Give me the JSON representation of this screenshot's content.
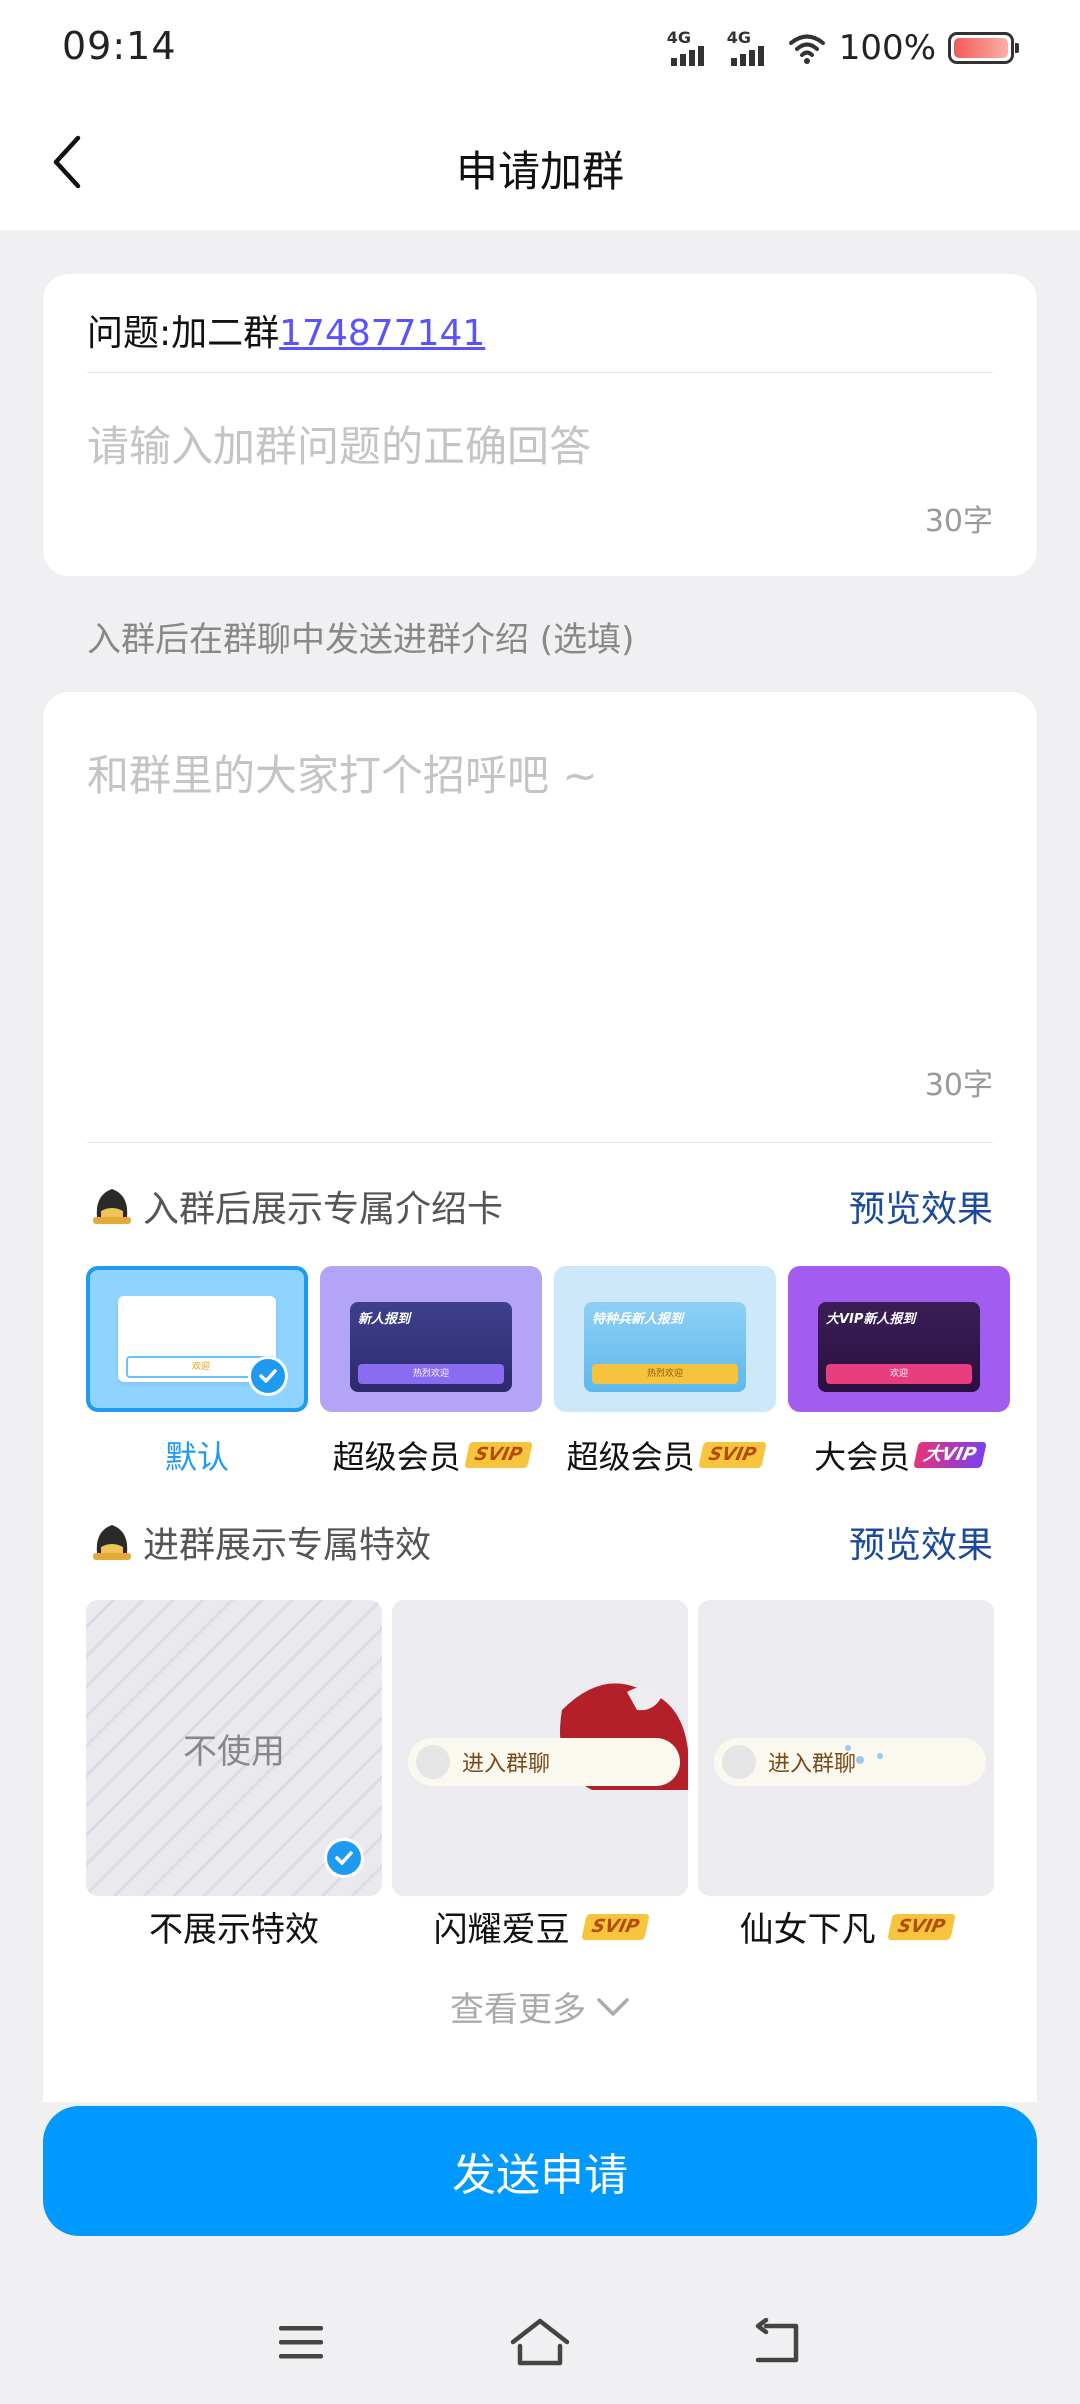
{
  "status_bar": {
    "time": "09:14",
    "signal_label": "4G",
    "battery_pct": "100%"
  },
  "header": {
    "title": "申请加群"
  },
  "question": {
    "prefix": "问题:加二群",
    "number": "174877141",
    "answer_placeholder": "请输入加群问题的正确回答",
    "counter": "30字"
  },
  "intro_hint": "入群后在群聊中发送进群介绍 (选填)",
  "intro": {
    "placeholder": "和群里的大家打个招呼吧 ~",
    "counter": "30字"
  },
  "intro_card_section": {
    "title": "入群后展示专属介绍卡",
    "preview": "预览效果",
    "cards": [
      {
        "label": "默认",
        "badge": "",
        "inner_title": "",
        "inner_button": "欢迎",
        "selected": true
      },
      {
        "label": "超级会员",
        "badge": "SVIP",
        "inner_title": "新人报到",
        "inner_button": "热烈欢迎"
      },
      {
        "label": "超级会员",
        "badge": "SVIP",
        "inner_title": "特种兵新人报到",
        "inner_button": "热烈欢迎"
      },
      {
        "label": "大会员",
        "badge": "大VIP",
        "inner_title": "大VIP新人报到",
        "inner_button": "欢迎"
      }
    ]
  },
  "effects_section": {
    "title": "进群展示专属特效",
    "preview": "预览效果",
    "none_text": "不使用",
    "pill_text": "进入群聊",
    "effects": [
      {
        "label": "不展示特效",
        "badge": "",
        "selected": true
      },
      {
        "label": "闪耀爱豆",
        "badge": "SVIP"
      },
      {
        "label": "仙女下凡",
        "badge": "SVIP"
      }
    ],
    "see_more": "查看更多"
  },
  "submit": {
    "label": "发送申请"
  },
  "colors": {
    "primary": "#0099ff",
    "link": "#5b52ff",
    "preview": "#1a4a9c"
  }
}
